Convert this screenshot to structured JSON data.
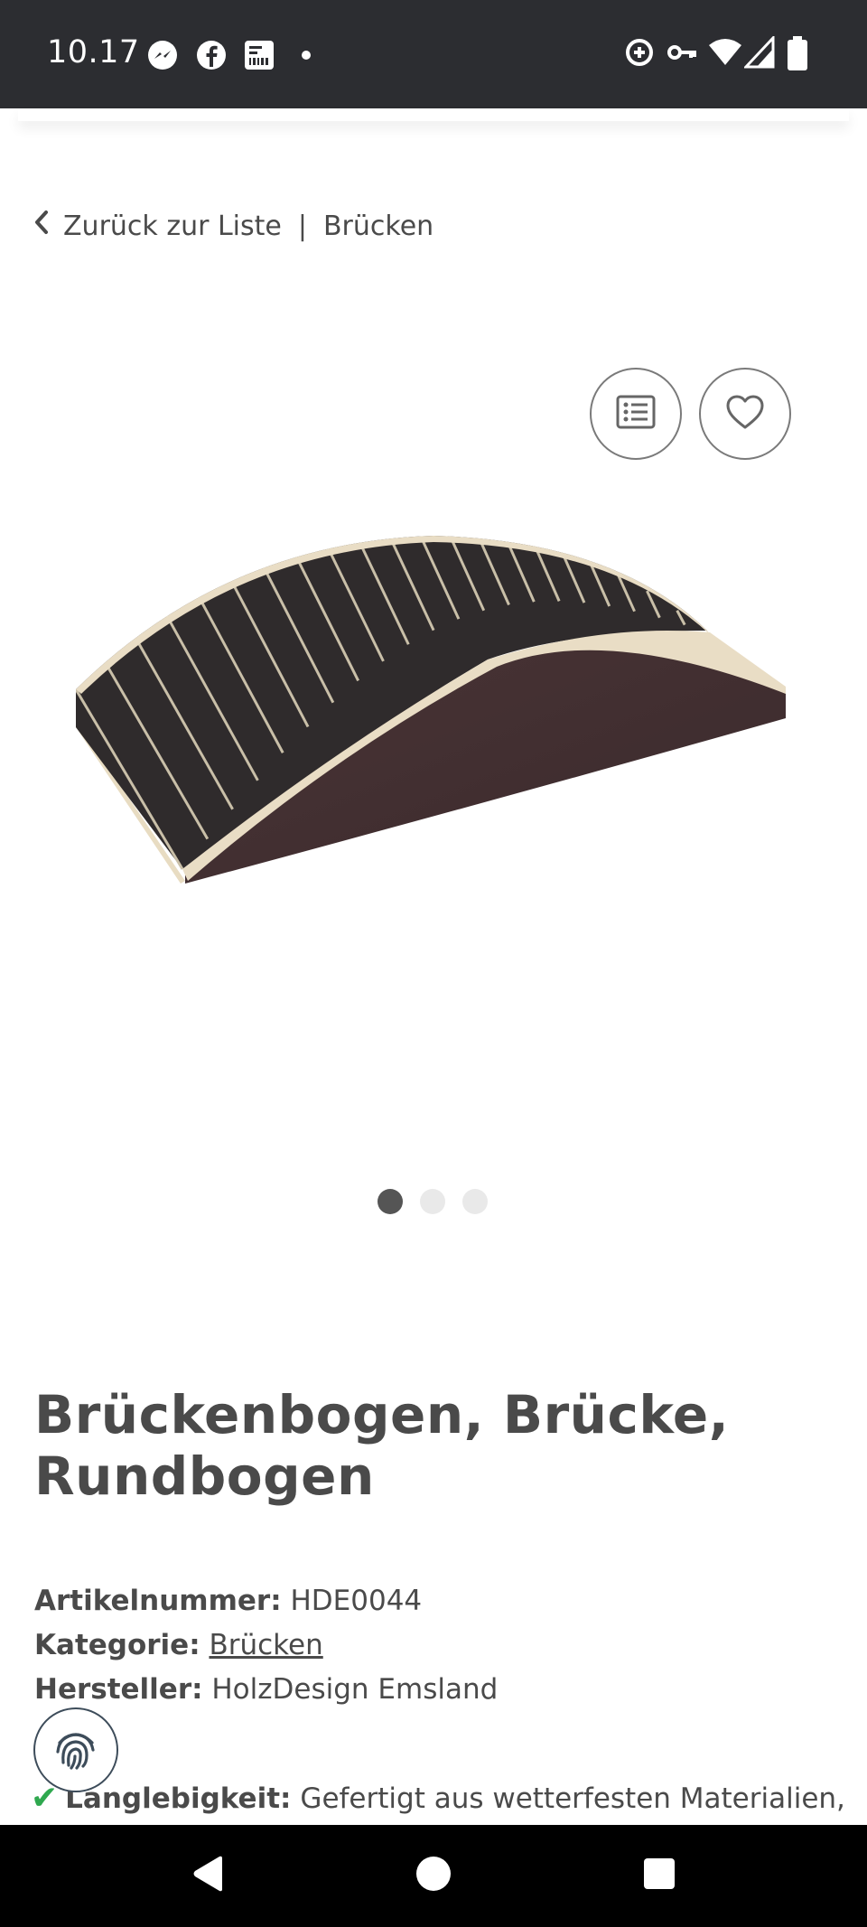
{
  "status_bar": {
    "time": "10.17",
    "left_icons": [
      "messenger-icon",
      "facebook-icon",
      "receipt-icon",
      "dot-icon"
    ],
    "right_icons": [
      "data-saver-icon",
      "vpn-key-icon",
      "wifi-icon",
      "signal-icon",
      "battery-icon"
    ]
  },
  "breadcrumb": {
    "back_label": "Zurück zur Liste",
    "separator": "|",
    "category": "Brücken"
  },
  "actions": {
    "list_icon": "list-icon",
    "favorite_icon": "heart-icon"
  },
  "carousel": {
    "slide_count": 3,
    "active_index": 0
  },
  "product": {
    "title": "Brückenbogen, Brücke, Rundbogen",
    "article_label": "Artikelnummer:",
    "article_value": "HDE0044",
    "category_label": "Kategorie:",
    "category_value": "Brücken",
    "manufacturer_label": "Hersteller:",
    "manufacturer_value": "HolzDesign Emsland"
  },
  "feature": {
    "check": "✔",
    "label": "Langlebigkeit:",
    "text": "Gefertigt aus wetterfesten Materialien,"
  },
  "colors": {
    "status_bar_bg": "#2c2d31",
    "text": "#4a4a4a",
    "check_green": "#2fa84f",
    "nav_bar_bg": "#000000"
  }
}
